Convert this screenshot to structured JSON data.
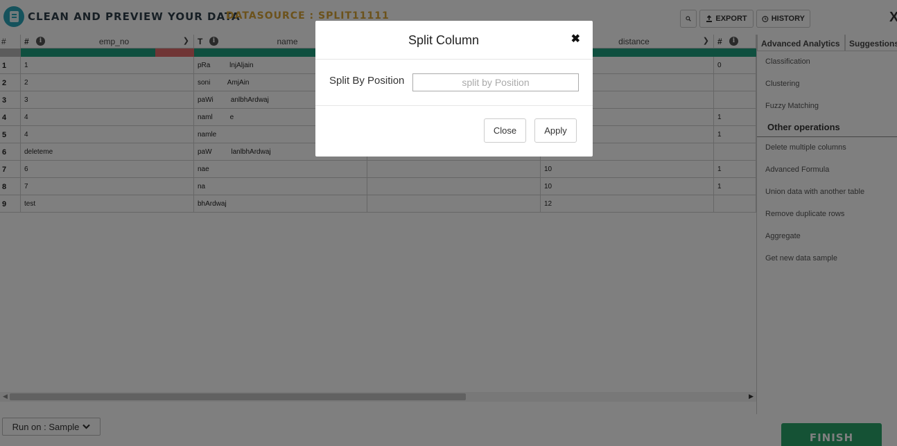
{
  "header": {
    "app_title": "CLEAN AND PREVIEW YOUR DATA",
    "datasource": "DATASOURCE : SPLIT11111",
    "export_label": "EXPORT",
    "history_label": "HISTORY",
    "close_glyph": "X"
  },
  "grid": {
    "rownum_header": "#",
    "columns": [
      {
        "type": "#",
        "name": "emp_no"
      },
      {
        "type": "T",
        "name": "name"
      },
      {
        "type": "",
        "name": ""
      },
      {
        "type": "",
        "name": "distance"
      },
      {
        "type": "#",
        "name": ""
      }
    ],
    "rows": [
      {
        "n": "1",
        "c": [
          "1",
          "pRa          lnjAljain",
          "",
          "",
          "0"
        ]
      },
      {
        "n": "2",
        "c": [
          "2",
          "soni         AmjAin",
          "",
          "",
          ""
        ]
      },
      {
        "n": "3",
        "c": [
          "3",
          "paWi         anlbhArdwaj",
          "",
          "",
          ""
        ]
      },
      {
        "n": "4",
        "c": [
          "4",
          "naml         e",
          "",
          "",
          "1"
        ]
      },
      {
        "n": "5",
        "c": [
          "4",
          "namle",
          "",
          "",
          "1"
        ]
      },
      {
        "n": "6",
        "c": [
          "deleteme",
          "paW          lanlbhArdwaj",
          "",
          "",
          ""
        ]
      },
      {
        "n": "7",
        "c": [
          "6",
          "nae",
          "",
          "10",
          "1"
        ]
      },
      {
        "n": "8",
        "c": [
          "7",
          "na",
          "",
          "10",
          "1"
        ]
      },
      {
        "n": "9",
        "c": [
          "test",
          "bhArdwaj",
          "",
          "12",
          ""
        ]
      }
    ]
  },
  "panel": {
    "tabs": [
      "Advanced Analytics",
      "Suggestions"
    ],
    "analytics": [
      "Classification",
      "Clustering",
      "Fuzzy Matching"
    ],
    "other_title": "Other operations",
    "other": [
      "Delete multiple columns",
      "Advanced Formula",
      "Union data with another table",
      "Remove duplicate rows",
      "Aggregate",
      "Get new data sample"
    ]
  },
  "footer": {
    "run_on": "Run on : Sample",
    "finish": "FINISH"
  },
  "modal": {
    "title": "Split Column",
    "field_label": "Split By Position",
    "field_value": "",
    "field_placeholder": "split by Position",
    "close_label": "Close",
    "apply_label": "Apply"
  },
  "colors": {
    "quality_good": "#1f9e7e",
    "quality_bad": "#e06b6b",
    "finish": "#2aa46b",
    "datasource": "#d8a437"
  }
}
